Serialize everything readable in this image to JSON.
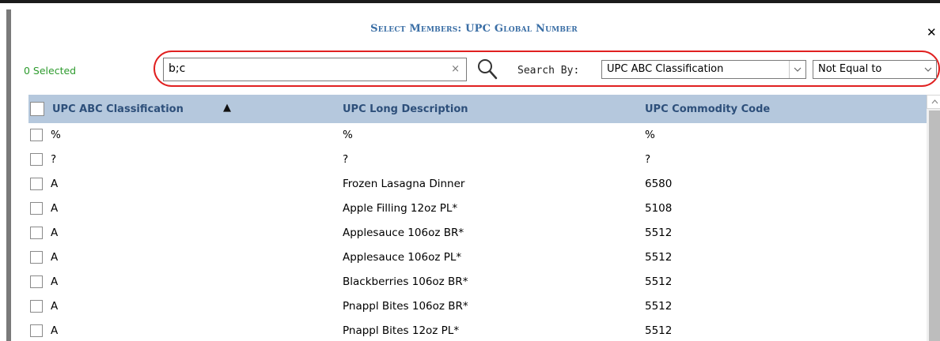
{
  "dialog": {
    "title": "Select Members: UPC Global Number",
    "close_glyph": "✕"
  },
  "toolbar": {
    "selected_count": "0 Selected",
    "search_value": "b;c",
    "clear_glyph": "×",
    "search_by_label": "Search By:",
    "search_by_field": "UPC ABC Classification",
    "operator": "Not Equal to"
  },
  "grid": {
    "columns": [
      "UPC ABC Classification",
      "UPC Long Description",
      "UPC Commodity Code"
    ],
    "sort_glyph": "▲",
    "rows": [
      {
        "abc": "%",
        "desc": "%",
        "code": "%"
      },
      {
        "abc": "?",
        "desc": "?",
        "code": "?"
      },
      {
        "abc": "A",
        "desc": "Frozen Lasagna Dinner",
        "code": "6580"
      },
      {
        "abc": "A",
        "desc": "Apple Filling 12oz PL*",
        "code": "5108"
      },
      {
        "abc": "A",
        "desc": "Applesauce 106oz BR*",
        "code": "5512"
      },
      {
        "abc": "A",
        "desc": "Applesauce 106oz PL*",
        "code": "5512"
      },
      {
        "abc": "A",
        "desc": "Blackberries 106oz BR*",
        "code": "5512"
      },
      {
        "abc": "A",
        "desc": "Pnappl Bites 106oz BR*",
        "code": "5512"
      },
      {
        "abc": "A",
        "desc": "Pnappl Bites 12oz PL*",
        "code": "5512"
      }
    ]
  },
  "icons": {
    "search": "search-icon",
    "close": "close-icon",
    "sort": "sort-ascending-icon",
    "dropdown": "chevron-down-icon"
  },
  "colors": {
    "title": "#3a6ea5",
    "selected_count": "#2e9b2e",
    "highlight": "#e02020",
    "header_bg": "#b5c8dd",
    "header_text": "#2d4f7a"
  }
}
